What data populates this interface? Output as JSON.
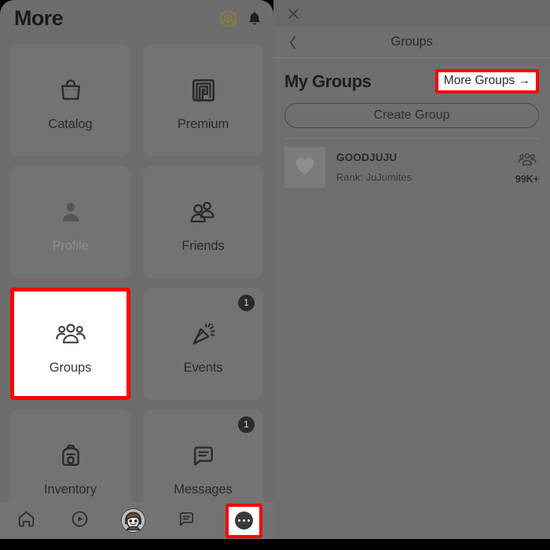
{
  "left_panel": {
    "header": {
      "title": "More",
      "robux_icon": "robux-hexagon-icon",
      "bell_icon": "notification-bell-icon"
    },
    "tiles": [
      {
        "label": "Catalog",
        "icon": "shopping-bag-icon",
        "badge": "",
        "state": "normal"
      },
      {
        "label": "Premium",
        "icon": "premium-spiral-icon",
        "badge": "",
        "state": "normal"
      },
      {
        "label": "Profile",
        "icon": "person-icon",
        "badge": "",
        "state": "dim"
      },
      {
        "label": "Friends",
        "icon": "friends-icon",
        "badge": "",
        "state": "normal"
      },
      {
        "label": "Groups",
        "icon": "groups-icon",
        "badge": "",
        "state": "selected"
      },
      {
        "label": "Events",
        "icon": "party-popper-icon",
        "badge": "1",
        "state": "normal"
      },
      {
        "label": "Inventory",
        "icon": "backpack-icon",
        "badge": "",
        "state": "normal"
      },
      {
        "label": "Messages",
        "icon": "message-bubble-icon",
        "badge": "1",
        "state": "normal"
      }
    ],
    "bottom_nav": [
      {
        "name": "home-nav",
        "icon": "home-icon",
        "state": "normal"
      },
      {
        "name": "discover-nav",
        "icon": "play-circle-icon",
        "state": "normal"
      },
      {
        "name": "avatar-nav",
        "icon": "avatar-icon",
        "state": "normal"
      },
      {
        "name": "chat-nav",
        "icon": "chat-icon",
        "state": "normal"
      },
      {
        "name": "more-nav",
        "icon": "ellipsis-icon",
        "state": "highlighted"
      }
    ]
  },
  "right_panel": {
    "close_icon": "close-x-icon",
    "back_icon": "chevron-left-icon",
    "title": "Groups",
    "section_title": "My Groups",
    "more_groups_label": "More Groups →",
    "create_group_label": "Create Group",
    "groups": [
      {
        "name": "GOODJUJU",
        "rank": "Rank: JuJumites",
        "members": "99K+",
        "thumb_icon": "heart-icon",
        "members_icon": "group-members-icon"
      }
    ]
  },
  "annotations": {
    "highlight_color": "#ff0000",
    "highlighted_elements": [
      "tile-groups",
      "more-groups-button",
      "more-nav-button"
    ]
  }
}
